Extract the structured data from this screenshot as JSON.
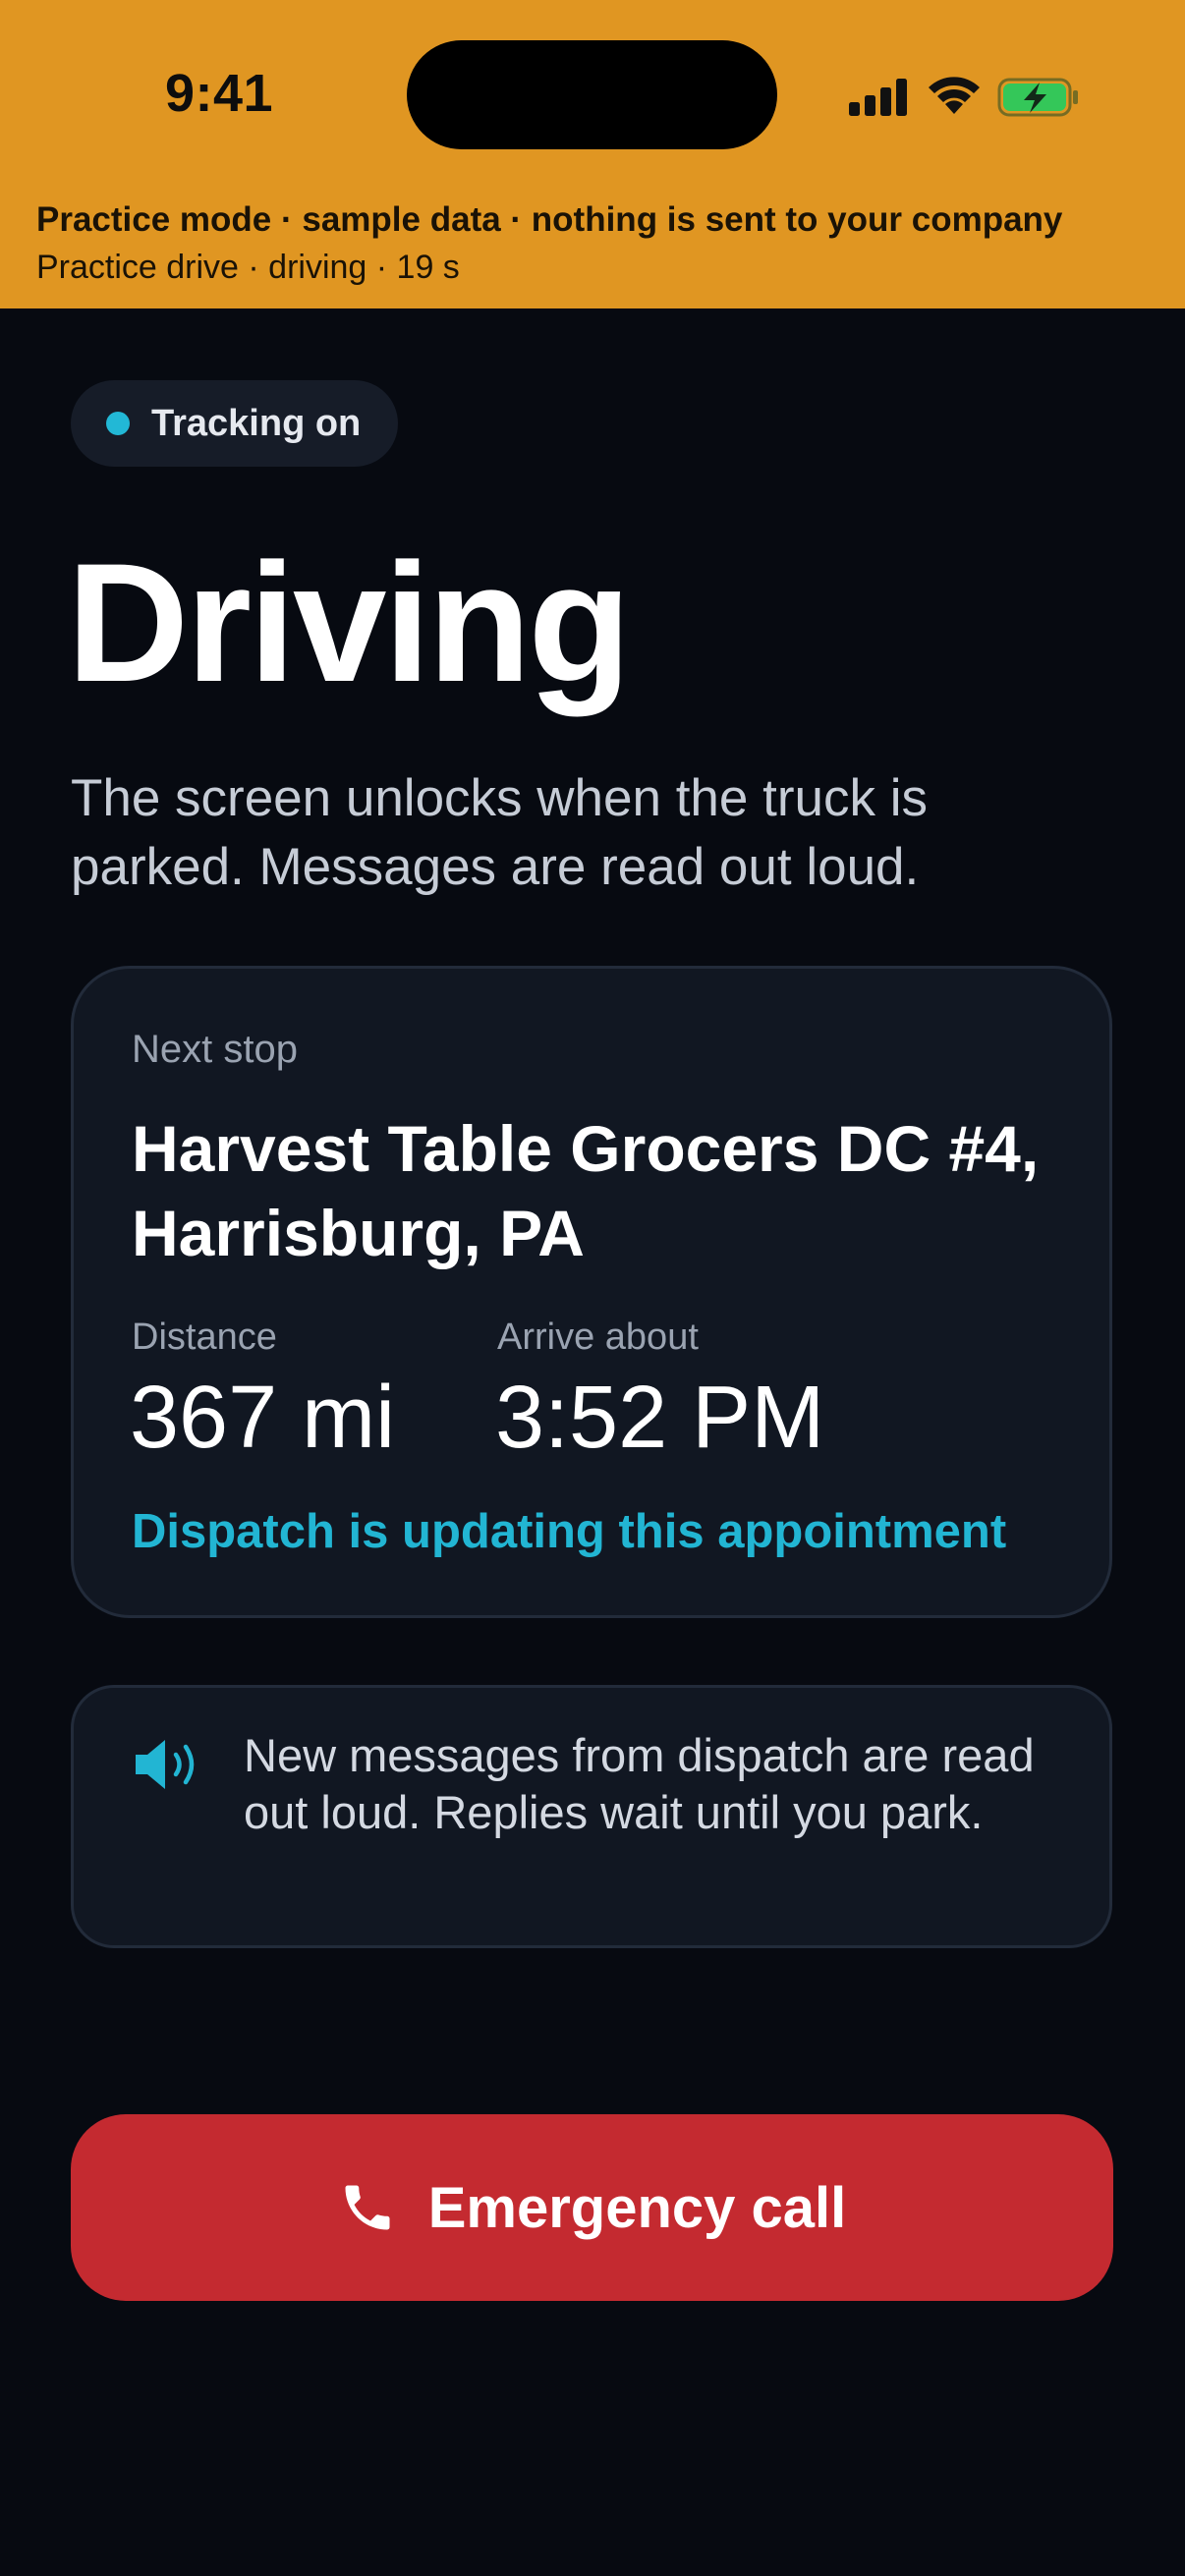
{
  "status_bar": {
    "time": "9:41"
  },
  "banner": {
    "title": "Practice mode · sample data · nothing is sent to your company",
    "subtitle": "Practice drive · driving · 19 s"
  },
  "tracking": {
    "label": "Tracking on"
  },
  "page": {
    "heading": "Driving",
    "description": "The screen unlocks when the truck is parked. Messages are read out loud."
  },
  "next_stop": {
    "kicker": "Next stop",
    "name": "Harvest Table Grocers DC #4, Harrisburg, PA",
    "distance_label": "Distance",
    "distance_value": "367 mi",
    "arrival_label": "Arrive about",
    "arrival_value": "3:52 PM",
    "update_notice": "Dispatch is updating this appointment"
  },
  "messages_info": {
    "text": "New messages from dispatch are read out loud. Replies wait until you park."
  },
  "emergency": {
    "label": "Emergency call"
  },
  "icons": {
    "signal": "cellular-signal-icon",
    "wifi": "wifi-icon",
    "battery": "battery-charging-icon",
    "speaker": "speaker-icon",
    "phone": "phone-icon"
  },
  "colors": {
    "banner_bg": "#e09622",
    "page_bg": "#070a11",
    "accent": "#22b5d3",
    "emergency": "#c42a30",
    "battery": "#34c759"
  }
}
